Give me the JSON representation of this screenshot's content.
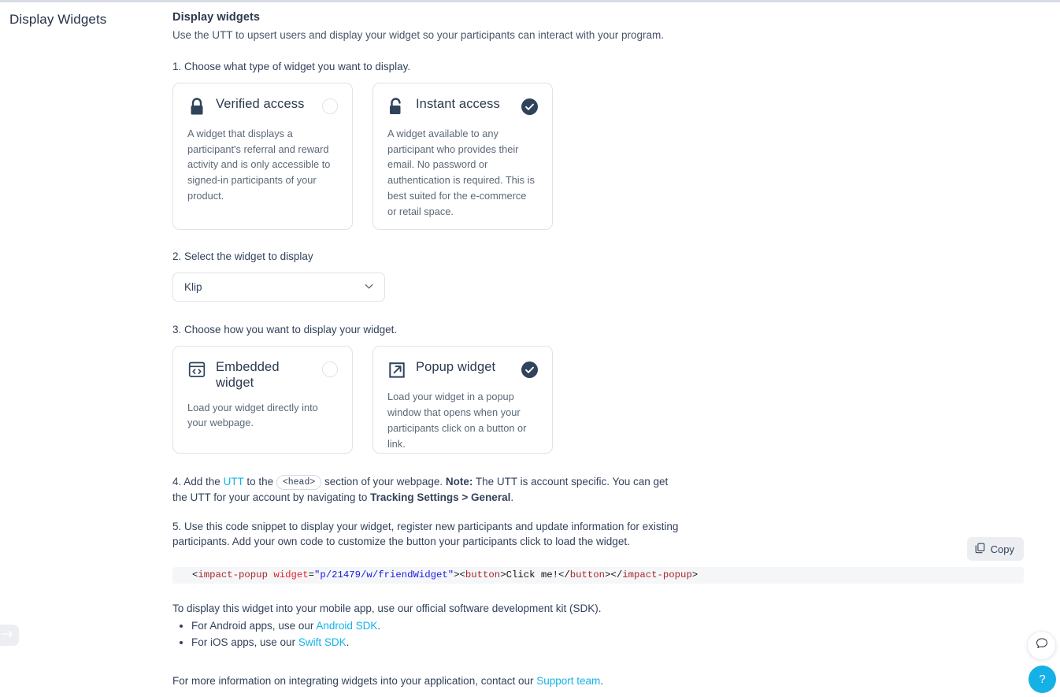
{
  "page_title": "Display Widgets",
  "section": {
    "title": "Display widgets",
    "lead": "Use the UTT to upsert users and display your widget so your participants can interact with your program."
  },
  "step1": {
    "label": "1. Choose what type of widget you want to display.",
    "cards": [
      {
        "icon": "lock-closed-icon",
        "title": "Verified access",
        "body": "A widget that displays a participant's referral and reward activity and is only accessible to signed-in participants of your product.",
        "selected": false
      },
      {
        "icon": "lock-open-icon",
        "title": "Instant access",
        "body": "A widget available to any participant who provides their email. No password or authentication is required. This is best suited for the e-commerce or retail space.",
        "selected": true
      }
    ]
  },
  "step2": {
    "label": "2. Select the widget to display",
    "select_value": "Klip",
    "chevron_icon": "chevron-down-icon"
  },
  "step3": {
    "label": "3. Choose how you want to display your widget.",
    "cards": [
      {
        "icon": "code-window-icon",
        "title": "Embedded widget",
        "body": "Load your widget directly into your webpage.",
        "selected": false
      },
      {
        "icon": "external-link-icon",
        "title": "Popup widget",
        "body": "Load your widget in a popup window that opens when your participants click on a button or link.",
        "selected": true
      }
    ]
  },
  "step4": {
    "prefix": "4. Add the ",
    "link": "UTT",
    "mid1": " to the ",
    "chip": "<head>",
    "mid2": " section of your webpage. ",
    "note_label": "Note:",
    "mid3": " The UTT is account specific. You can get the UTT for your account by navigating to ",
    "bold_path": "Tracking Settings > General",
    "suffix": "."
  },
  "step5": {
    "label": "5. Use this code snippet to display your widget, register new participants and update information for existing participants. Add your own code to customize the button your participants click to load the widget."
  },
  "copy": {
    "label": "Copy",
    "icon": "copy-icon"
  },
  "code": {
    "tokens": [
      {
        "t": "punct",
        "v": "<"
      },
      {
        "t": "tag",
        "v": "impact-popup"
      },
      {
        "t": "punct",
        "v": " "
      },
      {
        "t": "attr",
        "v": "widget"
      },
      {
        "t": "punct",
        "v": "="
      },
      {
        "t": "str",
        "v": "\"p/21479/w/friendWidget\""
      },
      {
        "t": "punct",
        "v": ">"
      },
      {
        "t": "punct",
        "v": "<"
      },
      {
        "t": "tag",
        "v": "button"
      },
      {
        "t": "punct",
        "v": ">"
      },
      {
        "t": "txt",
        "v": "Click me!"
      },
      {
        "t": "punct",
        "v": "</"
      },
      {
        "t": "tag",
        "v": "button"
      },
      {
        "t": "punct",
        "v": ">"
      },
      {
        "t": "punct",
        "v": "</"
      },
      {
        "t": "tag",
        "v": "impact-popup"
      },
      {
        "t": "punct",
        "v": ">"
      }
    ],
    "plain": "<impact-popup widget=\"p/21479/w/friendWidget\"><button>Click me!</button></impact-popup>"
  },
  "sdk": {
    "intro": "To display this widget into your mobile app, use our official software development kit (SDK).",
    "items": [
      {
        "prefix": "For Android apps, use our ",
        "link": "Android SDK",
        "suffix": "."
      },
      {
        "prefix": "For iOS apps, use our ",
        "link": "Swift SDK",
        "suffix": "."
      }
    ]
  },
  "footer": {
    "prefix": "For more information on integrating widgets into your application, contact our ",
    "link": "Support team",
    "suffix": "."
  },
  "floating": {
    "chat_icon": "chat-bubble-icon",
    "help_label": "?",
    "sidebar_toggle_icon": "arrow-right-icon"
  },
  "colors": {
    "accent": "#14b2e8",
    "dark": "#2b3a4e",
    "help_button": "#15b1e6"
  }
}
